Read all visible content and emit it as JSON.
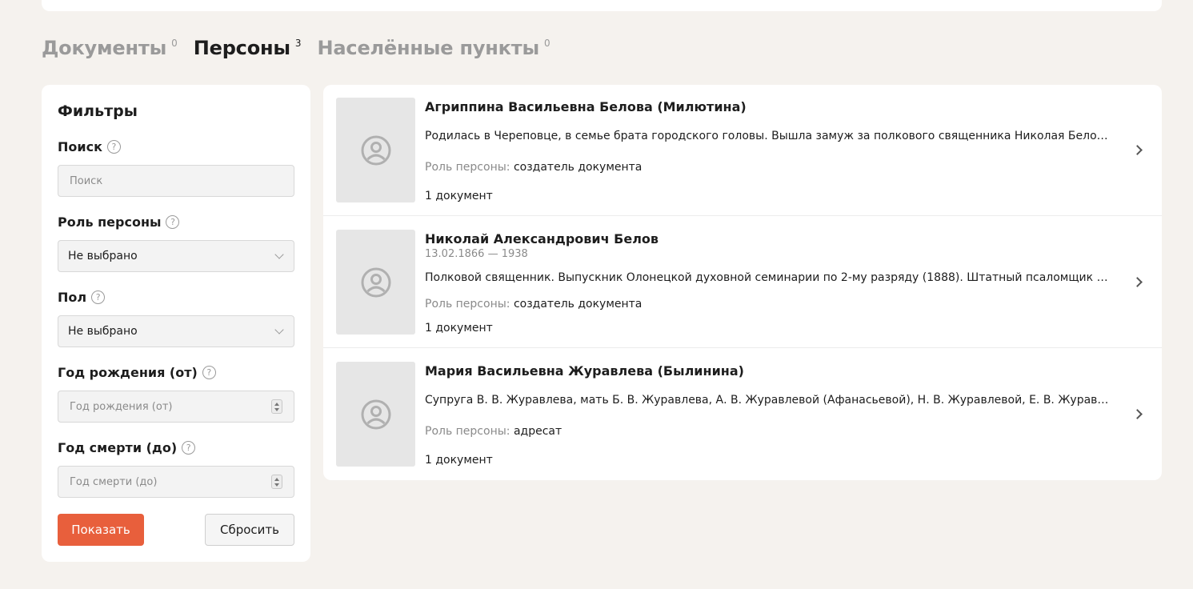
{
  "tabs": [
    {
      "label": "Документы",
      "count": "0",
      "active": false
    },
    {
      "label": "Персоны",
      "count": "3",
      "active": true
    },
    {
      "label": "Населённые пункты",
      "count": "0",
      "active": false
    }
  ],
  "filters": {
    "title": "Фильтры",
    "search": {
      "label": "Поиск",
      "placeholder": "Поиск"
    },
    "role": {
      "label": "Роль персоны",
      "value": "Не выбрано"
    },
    "gender": {
      "label": "Пол",
      "value": "Не выбрано"
    },
    "birth_year": {
      "label": "Год рождения (от)",
      "placeholder": "Год рождения (от)"
    },
    "death_year": {
      "label": "Год смерти (до)",
      "placeholder": "Год смерти (до)"
    },
    "help_glyph": "?",
    "show_label": "Показать",
    "reset_label": "Сбросить"
  },
  "persons": [
    {
      "name": "Агриппина Васильевна Белова (Милютина)",
      "dates": "",
      "description": "Родилась в Череповце, в семье брата городского головы. Вышла замуж за полкового священника Николая Белова.",
      "role_label": "Роль персоны:",
      "role": "создатель документа",
      "docs": "1 документ"
    },
    {
      "name": "Николай Александрович Белов",
      "dates": "13.02.1866 — 1938",
      "description": "Полковой священник. Выпускник Олонецкой духовной семинарии по 2-му разряду (1888). Штатный псаломщик церкви Бл...",
      "role_label": "Роль персоны:",
      "role": "создатель документа",
      "docs": "1 документ"
    },
    {
      "name": "Мария Васильевна Журавлева (Былинина)",
      "dates": "",
      "description": "Супруга В. В. Журавлева, мать Б. В. Журавлева, А. В. Журавлевой (Афанасьевой), Н. В. Журавлевой, Е. В. Журавлевой (Гинди...",
      "role_label": "Роль персоны:",
      "role": "адресат",
      "docs": "1 документ"
    }
  ],
  "colors": {
    "accent": "#e85f3c",
    "background": "#f5f2ee"
  },
  "icons": {
    "help": "question-circle-icon",
    "avatar": "person-placeholder-icon",
    "chevron": "chevron-right-icon"
  }
}
